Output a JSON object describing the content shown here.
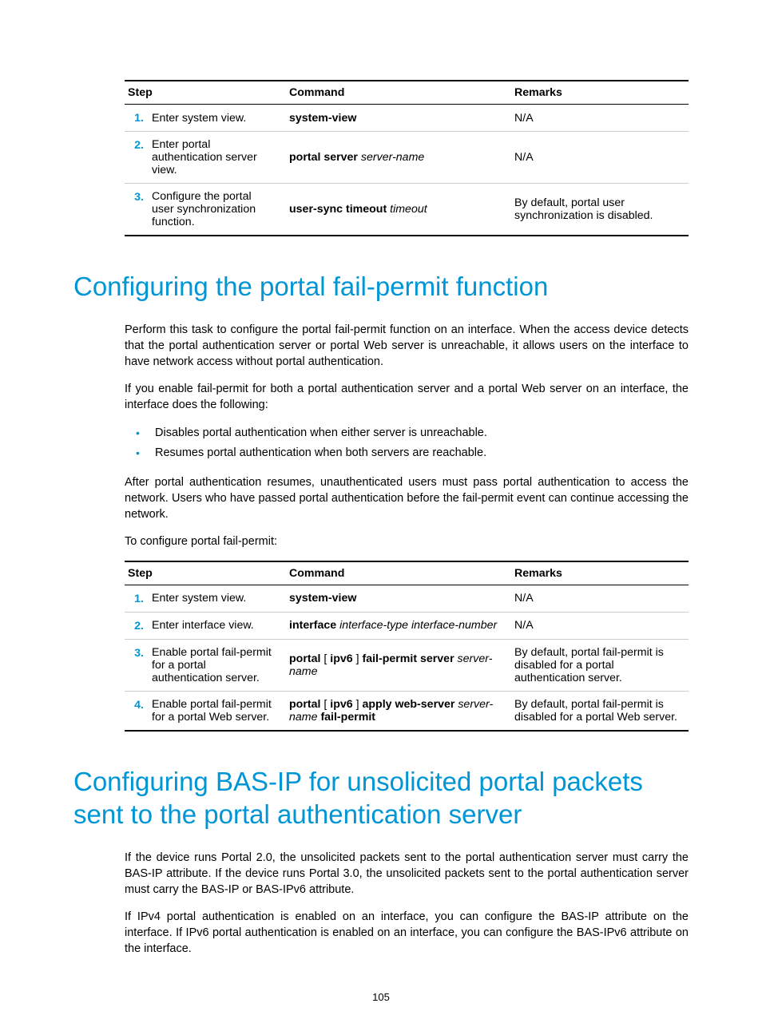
{
  "table1": {
    "headers": {
      "step": "Step",
      "command": "Command",
      "remarks": "Remarks"
    },
    "rows": [
      {
        "num": "1.",
        "desc": "Enter system view.",
        "cmd_bold": "system-view",
        "remarks": "N/A"
      },
      {
        "num": "2.",
        "desc": "Enter portal authentication server view.",
        "cmd_bold": "portal server",
        "cmd_ital": " server-name",
        "remarks": "N/A"
      },
      {
        "num": "3.",
        "desc": "Configure the portal user synchronization function.",
        "cmd_bold": "user-sync timeout",
        "cmd_ital": " timeout",
        "remarks": "By default, portal user synchronization is disabled."
      }
    ]
  },
  "heading1": "Configuring the portal fail-permit function",
  "para1": "Perform this task to configure the portal fail-permit function on an interface. When the access device detects that the portal authentication server or portal Web server is unreachable, it allows users on the interface to have network access without portal authentication.",
  "para2": "If you enable fail-permit for both a portal authentication server and a portal Web server on an interface, the interface does the following:",
  "bullets1": [
    "Disables portal authentication when either server is unreachable.",
    "Resumes portal authentication when both servers are reachable."
  ],
  "para3": "After portal authentication resumes, unauthenticated users must pass portal authentication to access the network. Users who have passed portal authentication before the fail-permit event can continue accessing the network.",
  "para4": "To configure portal fail-permit:",
  "table2": {
    "headers": {
      "step": "Step",
      "command": "Command",
      "remarks": "Remarks"
    },
    "rows": [
      {
        "num": "1.",
        "desc": "Enter system view.",
        "cmd_parts": [
          {
            "t": "system-view",
            "b": true
          }
        ],
        "remarks": "N/A"
      },
      {
        "num": "2.",
        "desc": "Enter interface view.",
        "cmd_parts": [
          {
            "t": "interface",
            "b": true
          },
          {
            "t": " interface-type interface-number",
            "i": true
          }
        ],
        "remarks": "N/A"
      },
      {
        "num": "3.",
        "desc": "Enable portal fail-permit for a portal authentication server.",
        "cmd_parts": [
          {
            "t": "portal",
            "b": true
          },
          {
            "t": " [ "
          },
          {
            "t": "ipv6",
            "b": true
          },
          {
            "t": " ] "
          },
          {
            "t": "fail-permit server",
            "b": true
          },
          {
            "t": " server-name",
            "i": true
          }
        ],
        "remarks": "By default, portal fail-permit is disabled for a portal authentication server."
      },
      {
        "num": "4.",
        "desc": "Enable portal fail-permit for a portal Web server.",
        "cmd_parts": [
          {
            "t": "portal",
            "b": true
          },
          {
            "t": " [ "
          },
          {
            "t": "ipv6",
            "b": true
          },
          {
            "t": " ] "
          },
          {
            "t": "apply web-server",
            "b": true
          },
          {
            "t": " server-name ",
            "i": true
          },
          {
            "t": "fail-permit",
            "b": true
          }
        ],
        "remarks": "By default, portal fail-permit is disabled for a portal Web server."
      }
    ]
  },
  "heading2": "Configuring BAS-IP for unsolicited portal packets sent to the portal authentication server",
  "para5": "If the device runs Portal 2.0, the unsolicited packets sent to the portal authentication server must carry the BAS-IP attribute. If the device runs Portal 3.0, the unsolicited packets sent to the portal authentication server must carry the BAS-IP or BAS-IPv6 attribute.",
  "para6": "If IPv4 portal authentication is enabled on an interface, you can configure the BAS-IP attribute on the interface. If IPv6 portal authentication is enabled on an interface, you can configure the BAS-IPv6 attribute on the interface.",
  "pageNumber": "105"
}
